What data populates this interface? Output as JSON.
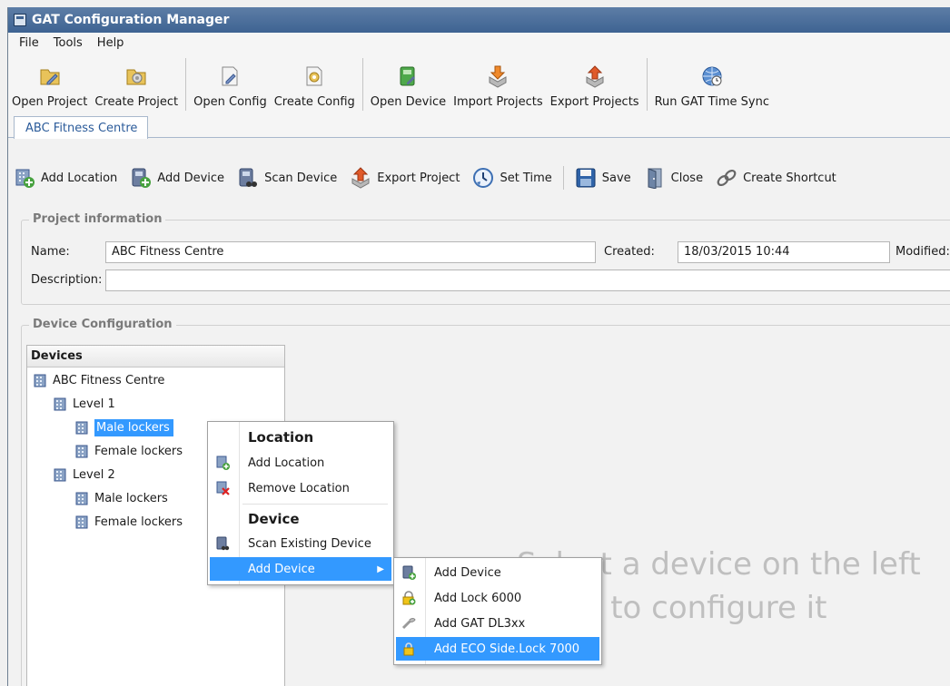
{
  "window": {
    "title": "GAT Configuration Manager"
  },
  "menu": [
    "File",
    "Tools",
    "Help"
  ],
  "main_toolbar": [
    {
      "label": "Open Project",
      "icon": "open-project-icon"
    },
    {
      "label": "Create Project",
      "icon": "create-project-icon"
    },
    {
      "label": "Open Config",
      "icon": "open-config-icon"
    },
    {
      "label": "Create Config",
      "icon": "create-config-icon"
    },
    {
      "label": "Open Device",
      "icon": "open-device-icon"
    },
    {
      "label": "Import Projects",
      "icon": "import-projects-icon"
    },
    {
      "label": "Export Projects",
      "icon": "export-projects-icon"
    },
    {
      "label": "Run GAT Time Sync",
      "icon": "time-sync-icon"
    }
  ],
  "tab": {
    "label": "ABC Fitness Centre"
  },
  "project_toolbar": [
    {
      "label": "Add Location"
    },
    {
      "label": "Add Device"
    },
    {
      "label": "Scan Device"
    },
    {
      "label": "Export Project"
    },
    {
      "label": "Set Time"
    },
    {
      "label": "Save"
    },
    {
      "label": "Close"
    },
    {
      "label": "Create Shortcut"
    }
  ],
  "project_info": {
    "title": "Project information",
    "name_label": "Name:",
    "name_value": "ABC Fitness Centre",
    "created_label": "Created:",
    "created_value": "18/03/2015 10:44",
    "modified_label": "Modified:",
    "description_label": "Description:",
    "description_value": ""
  },
  "device_config": {
    "title": "Device Configuration",
    "devices_header": "Devices",
    "tree": [
      {
        "label": "ABC Fitness Centre"
      },
      {
        "label": "Level 1"
      },
      {
        "label": "Male lockers",
        "selected": true
      },
      {
        "label": "Female lockers"
      },
      {
        "label": "Level 2"
      },
      {
        "label": "Male lockers"
      },
      {
        "label": "Female lockers"
      }
    ],
    "placeholder_line1": "Select a device on the left",
    "placeholder_line2": "to configure it"
  },
  "context_menu": {
    "location_header": "Location",
    "add_location": "Add Location",
    "remove_location": "Remove Location",
    "device_header": "Device",
    "scan_existing": "Scan Existing Device",
    "add_device": "Add Device"
  },
  "submenu": {
    "add_device": "Add Device",
    "add_lock_6000": "Add Lock 6000",
    "add_gat_dl3xx": "Add GAT DL3xx",
    "add_eco_side_lock": "Add ECO Side.Lock 7000"
  },
  "colors": {
    "selection": "#3399ff",
    "title_bar": "#3e6392",
    "tab_text": "#2b5b9a"
  }
}
